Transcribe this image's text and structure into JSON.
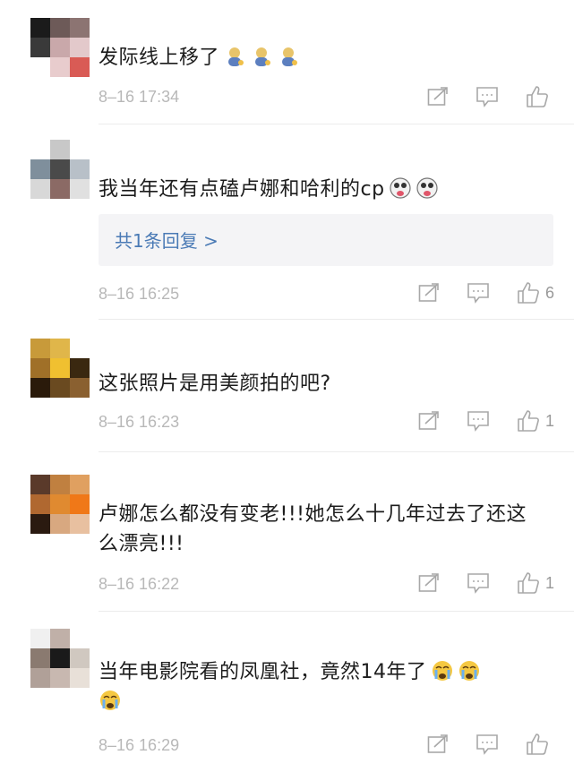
{
  "comments": [
    {
      "text": "发际线上移了",
      "emoji": [
        "poop-face-emoji",
        "poop-face-emoji",
        "poop-face-emoji"
      ],
      "time": "8–16 17:34",
      "likes": ""
    },
    {
      "text": "我当年还有点磕卢娜和哈利的cp",
      "emoji": [
        "dog-face-emoji",
        "dog-face-emoji"
      ],
      "time": "8–16 16:25",
      "likes": "6",
      "reply_link": "共1条回复 >"
    },
    {
      "text": "这张照片是用美颜拍的吧?",
      "emoji": [],
      "time": "8–16 16:23",
      "likes": "1"
    },
    {
      "text": "卢娜怎么都没有变老!!!她怎么十几年过去了还这么漂亮!!!",
      "emoji": [],
      "time": "8–16 16:22",
      "likes": "1"
    },
    {
      "text": "当年电影院看的凤凰社，竟然14年了",
      "emoji": [
        "crying-face-emoji",
        "crying-face-emoji",
        "crying-face-emoji"
      ],
      "time": "8–16 16:29",
      "likes": ""
    }
  ],
  "colors": {
    "text": "#1c1c1c",
    "meta": "#b8b8b8",
    "link": "#4a7ab5",
    "reply_bg": "#f4f4f6"
  }
}
